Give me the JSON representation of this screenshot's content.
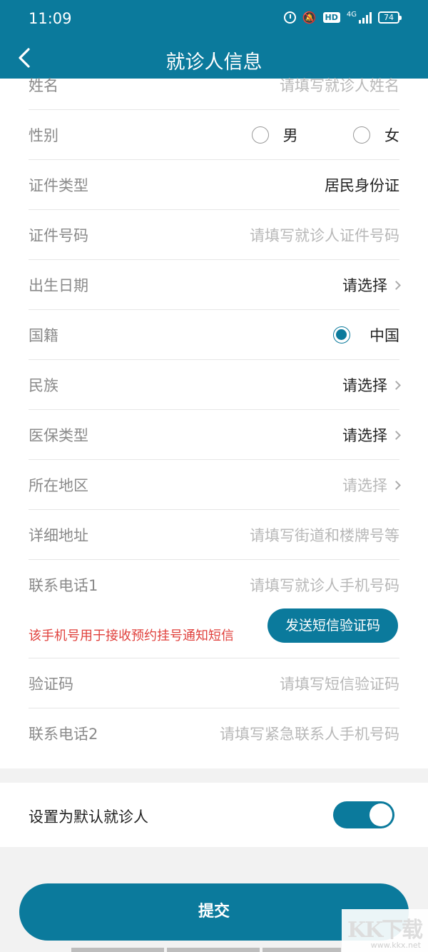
{
  "status_bar": {
    "time": "11:09",
    "network": "4G",
    "hd_badge": "HD",
    "battery": "74"
  },
  "header": {
    "title": "就诊人信息",
    "back_icon": "chevron-left-icon"
  },
  "form": {
    "name": {
      "label": "姓名",
      "placeholder": "请填写就诊人姓名"
    },
    "gender": {
      "label": "性别",
      "options": [
        "男",
        "女"
      ],
      "selected": null
    },
    "id_type": {
      "label": "证件类型",
      "value": "居民身份证"
    },
    "id_number": {
      "label": "证件号码",
      "placeholder": "请填写就诊人证件号码"
    },
    "birth_date": {
      "label": "出生日期",
      "value": "请选择"
    },
    "nationality": {
      "label": "国籍",
      "value": "中国",
      "selected": true
    },
    "ethnicity": {
      "label": "民族",
      "value": "请选择"
    },
    "insurance_type": {
      "label": "医保类型",
      "value": "请选择"
    },
    "region": {
      "label": "所在地区",
      "placeholder": "请选择"
    },
    "address": {
      "label": "详细地址",
      "placeholder": "请填写街道和楼牌号等"
    },
    "phone1": {
      "label": "联系电话1",
      "placeholder": "请填写就诊人手机号码",
      "notice": "该手机号用于接收预约挂号通知短信",
      "sms_button": "发送短信验证码"
    },
    "verify_code": {
      "label": "验证码",
      "placeholder": "请填写短信验证码"
    },
    "phone2": {
      "label": "联系电话2",
      "placeholder": "请填写紧急联系人手机号码"
    }
  },
  "default_patient": {
    "label": "设置为默认就诊人",
    "enabled": true
  },
  "submit": {
    "label": "提交"
  },
  "watermark": {
    "logo": "KK下载",
    "url": "www.kkx.net"
  },
  "colors": {
    "primary": "#0b7a9c",
    "notice": "#e0403c",
    "label": "#8a8a8a",
    "placeholder": "#b8b8b8"
  }
}
